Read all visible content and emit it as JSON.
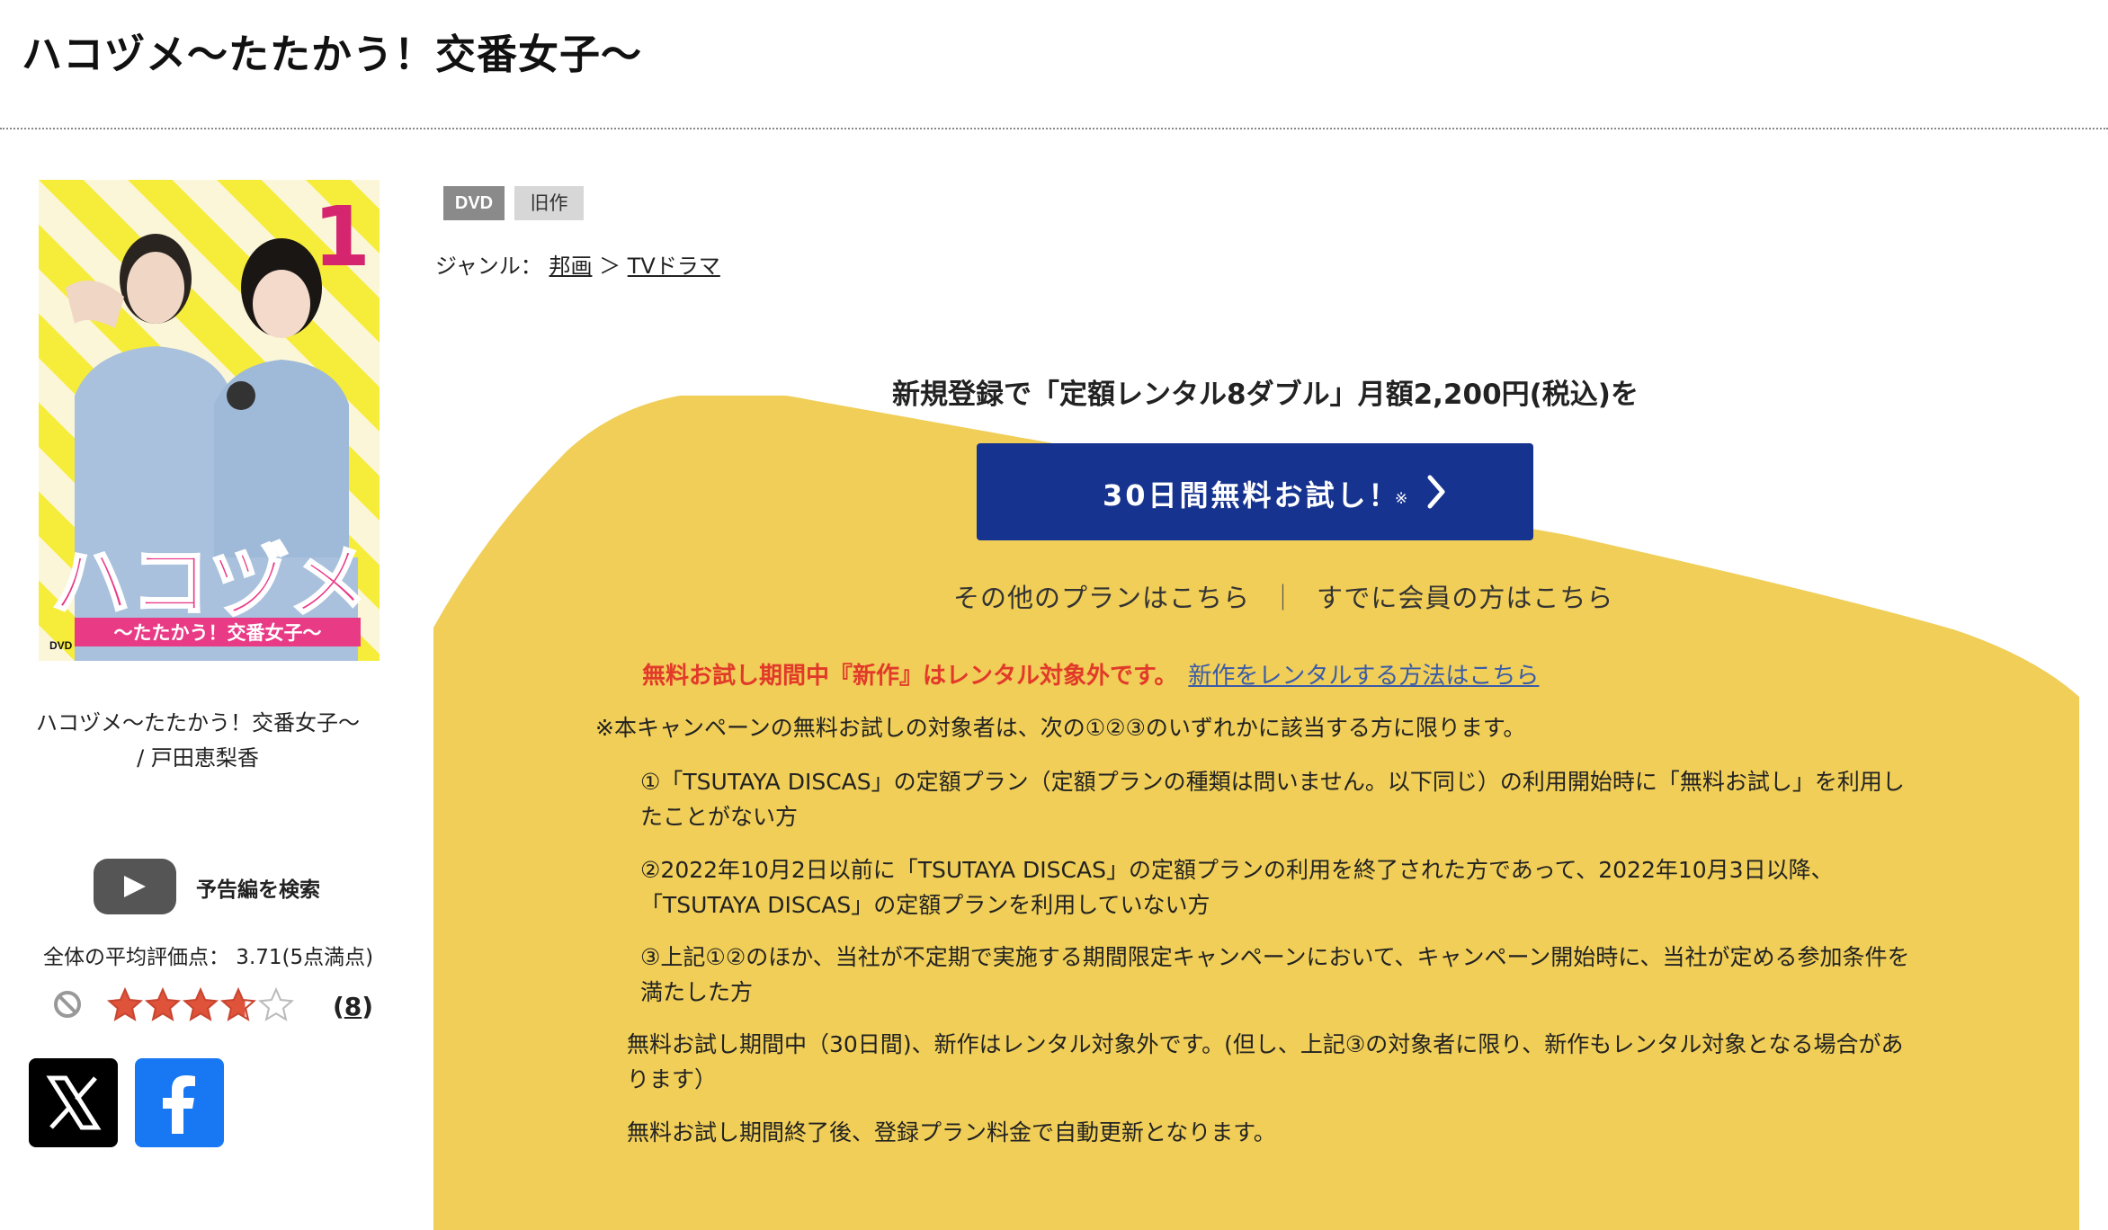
{
  "page": {
    "title": "ハコヅメ〜たたかう！交番女子〜"
  },
  "item": {
    "cover_number": "1",
    "cover_logo": "ハコヅメ",
    "cover_subtitle": "〜たたかう！交番女子〜",
    "cover_dvd_mark": "DVD",
    "title": "ハコヅメ〜たたかう！交番女子〜",
    "cast": "/ 戸田恵梨香",
    "badges": {
      "format": "DVD",
      "status": "旧作"
    },
    "genre": {
      "label": "ジャンル：",
      "parent": "邦画",
      "separator": "＞",
      "child": "TVドラマ"
    }
  },
  "trailer": {
    "label": "予告編を検索",
    "icon": "youtube-play-icon"
  },
  "rating": {
    "label": "全体の平均評価点： 3.71(5点満点)",
    "value": 3.71,
    "max": 5,
    "count_open": "(",
    "count": "8",
    "count_close": ")"
  },
  "share": {
    "x_icon": "x-logo-icon",
    "facebook_icon": "facebook-logo-icon"
  },
  "campaign": {
    "headline": "新規登録で「定額レンタル8ダブル」月額2,200円(税込)を",
    "button_label": "30日間無料お試し！",
    "button_mark": "※",
    "other_plans": "その他のプランはこちら",
    "separator": "｜",
    "members": "すでに会員の方はこちら",
    "notice_red": "無料お試し期間中『新作』はレンタル対象外です。",
    "notice_link": "新作をレンタルする方法はこちら",
    "eligibility_intro": "※本キャンペーンの無料お試しの対象者は、次の①②③のいずれかに該当する方に限ります。",
    "conditions": [
      "①「TSUTAYA DISCAS」の定額プラン（定額プランの種類は問いません。以下同じ）の利用開始時に「無料お試し」を利用したことがない方",
      "②2022年10月2日以前に「TSUTAYA DISCAS」の定額プランの利用を終了された方であって、2022年10月3日以降、「TSUTAYA DISCAS」の定額プランを利用していない方",
      "③上記①②のほか、当社が不定期で実施する期間限定キャンペーンにおいて、キャンペーン開始時に、当社が定める参加条件を満たした方"
    ],
    "notes": [
      "無料お試し期間中（30日間)、新作はレンタル対象外です。(但し、上記③の対象者に限り、新作もレンタル対象となる場合があります）",
      "無料お試し期間終了後、登録プラン料金で自動更新となります。"
    ]
  },
  "colors": {
    "campaign_yellow": "#f0ce57",
    "button_blue": "#16338f",
    "notice_red": "#e23a2a",
    "link_blue": "#3a5ba8",
    "facebook_blue": "#1877f2"
  }
}
